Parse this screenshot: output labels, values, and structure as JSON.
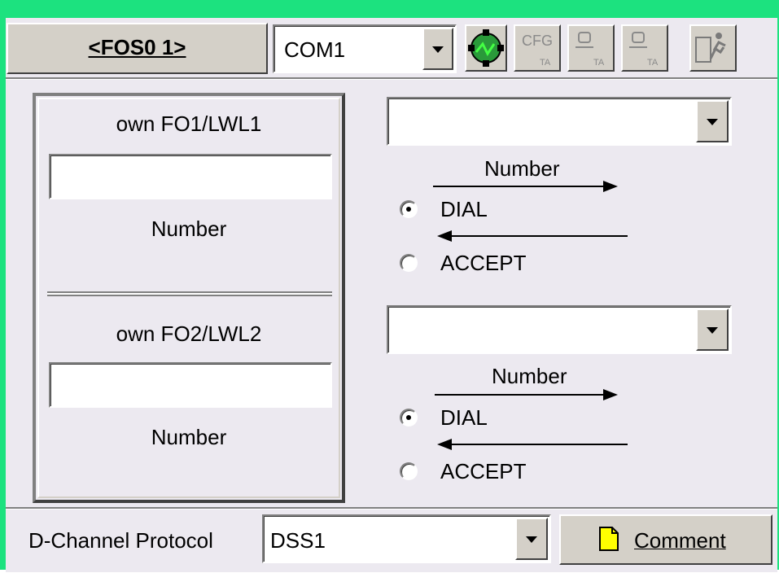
{
  "toolbar": {
    "device_button_label": "<FOS0 1>",
    "port_value": "COM1",
    "icons": [
      "connection-icon",
      "cfg-ta-icon",
      "ta-user-icon",
      "ta-user-2-icon",
      "exit-runner-icon"
    ],
    "cfg_label": "CFG",
    "ta_label": "TA"
  },
  "left_group": {
    "fo1": {
      "title": "own FO1/LWL1",
      "number_value": "",
      "number_label": "Number"
    },
    "fo2": {
      "title": "own FO2/LWL2",
      "number_value": "",
      "number_label": "Number"
    }
  },
  "right_group": {
    "line1": {
      "dropdown_value": "",
      "number_label": "Number",
      "dial_label": "DIAL",
      "accept_label": "ACCEPT",
      "selected": "DIAL"
    },
    "line2": {
      "dropdown_value": "",
      "number_label": "Number",
      "dial_label": "DIAL",
      "accept_label": "ACCEPT",
      "selected": "DIAL"
    }
  },
  "footer": {
    "protocol_label": "D-Channel Protocol",
    "protocol_value": "DSS1",
    "comment_button_label": "Comment"
  },
  "colors": {
    "frame": "#1ce27f",
    "panel": "#ece9f0",
    "connect_icon_bg": "#2a9a3a",
    "comment_icon": "#ffff00"
  }
}
